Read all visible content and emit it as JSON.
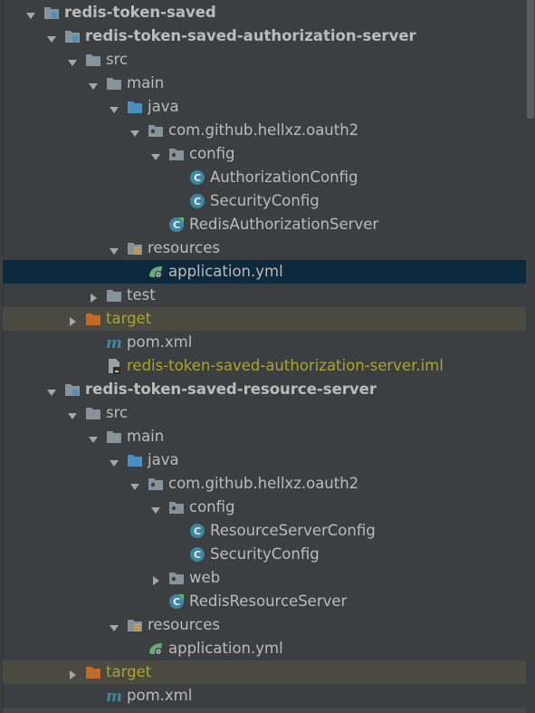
{
  "tree": [
    {
      "label": "redis-token-saved",
      "depth": 0,
      "expanded": true,
      "icon": "module-icon",
      "bold": true
    },
    {
      "label": "redis-token-saved-authorization-server",
      "depth": 1,
      "expanded": true,
      "icon": "module-icon",
      "bold": true
    },
    {
      "label": "src",
      "depth": 2,
      "expanded": true,
      "icon": "folder-icon"
    },
    {
      "label": "main",
      "depth": 3,
      "expanded": true,
      "icon": "folder-icon"
    },
    {
      "label": "java",
      "depth": 4,
      "expanded": true,
      "icon": "source-folder-icon"
    },
    {
      "label": "com.github.hellxz.oauth2",
      "depth": 5,
      "expanded": true,
      "icon": "package-icon"
    },
    {
      "label": "config",
      "depth": 6,
      "expanded": true,
      "icon": "package-icon"
    },
    {
      "label": "AuthorizationConfig",
      "depth": 7,
      "icon": "class-icon"
    },
    {
      "label": "SecurityConfig",
      "depth": 7,
      "icon": "class-icon"
    },
    {
      "label": "RedisAuthorizationServer",
      "depth": 6,
      "icon": "spring-boot-class-icon"
    },
    {
      "label": "resources",
      "depth": 4,
      "expanded": true,
      "icon": "resources-folder-icon"
    },
    {
      "label": "application.yml",
      "depth": 5,
      "icon": "spring-yml-icon",
      "selected": true
    },
    {
      "label": "test",
      "depth": 3,
      "expanded": false,
      "icon": "folder-icon"
    },
    {
      "label": "target",
      "depth": 2,
      "expanded": false,
      "icon": "excluded-folder-icon",
      "excluded": true
    },
    {
      "label": "pom.xml",
      "depth": 3,
      "icon": "maven-icon"
    },
    {
      "label": "redis-token-saved-authorization-server.iml",
      "depth": 3,
      "icon": "iml-file-icon",
      "olive": true
    },
    {
      "label": "redis-token-saved-resource-server",
      "depth": 1,
      "expanded": true,
      "icon": "module-icon",
      "bold": true
    },
    {
      "label": "src",
      "depth": 2,
      "expanded": true,
      "icon": "folder-icon"
    },
    {
      "label": "main",
      "depth": 3,
      "expanded": true,
      "icon": "folder-icon"
    },
    {
      "label": "java",
      "depth": 4,
      "expanded": true,
      "icon": "source-folder-icon"
    },
    {
      "label": "com.github.hellxz.oauth2",
      "depth": 5,
      "expanded": true,
      "icon": "package-icon"
    },
    {
      "label": "config",
      "depth": 6,
      "expanded": true,
      "icon": "package-icon"
    },
    {
      "label": "ResourceServerConfig",
      "depth": 7,
      "icon": "class-icon"
    },
    {
      "label": "SecurityConfig",
      "depth": 7,
      "icon": "class-icon"
    },
    {
      "label": "web",
      "depth": 6,
      "expanded": false,
      "icon": "package-icon"
    },
    {
      "label": "RedisResourceServer",
      "depth": 6,
      "icon": "spring-boot-class-icon"
    },
    {
      "label": "resources",
      "depth": 4,
      "expanded": true,
      "icon": "resources-folder-icon"
    },
    {
      "label": "application.yml",
      "depth": 5,
      "icon": "spring-yml-icon"
    },
    {
      "label": "target",
      "depth": 2,
      "expanded": false,
      "icon": "excluded-folder-icon",
      "excluded": true
    },
    {
      "label": "pom.xml",
      "depth": 3,
      "icon": "maven-icon"
    }
  ],
  "colors": {
    "background": "#3c3f41",
    "text": "#bbbbbb",
    "selected_row": "#0d293e",
    "excluded_row": "#4a4a40",
    "excluded_text": "#a9a52f",
    "folder": "#87939a",
    "source_folder": "#4a8fc0",
    "class_circle": "#3e86a0",
    "target_folder": "#c16a2b",
    "spring_green": "#6aab73"
  }
}
